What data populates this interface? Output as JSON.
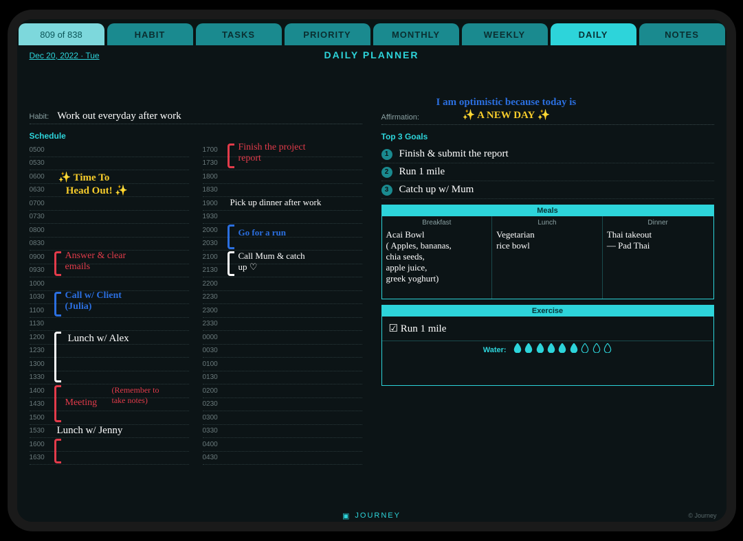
{
  "page_counter": "809 of 838",
  "tabs": {
    "habit": "HABIT",
    "tasks": "TASKS",
    "priority": "PRIORITY",
    "monthly": "MONTHLY",
    "weekly": "WEEKLY",
    "daily": "DAILY",
    "notes": "NOTES"
  },
  "date": "Dec 20, 2022 · Tue",
  "page_title": "DAILY PLANNER",
  "habit_field_label": "Habit:",
  "habit_value": "Work out everyday after work",
  "affirmation_field_label": "Affirmation:",
  "affirmation_line1": "I am optimistic because today is",
  "affirmation_line2": "✨ A NEW DAY ✨",
  "schedule_label": "Schedule",
  "schedule_times_col1": [
    "0500",
    "0530",
    "0600",
    "0630",
    "0700",
    "0730",
    "0800",
    "0830",
    "0900",
    "0930",
    "1000",
    "1030",
    "1100",
    "1130",
    "1200",
    "1230",
    "1300",
    "1330",
    "1400",
    "1430",
    "1500",
    "1530",
    "1600",
    "1630"
  ],
  "schedule_times_col2": [
    "1700",
    "1730",
    "1800",
    "1830",
    "1900",
    "1930",
    "2000",
    "2030",
    "2100",
    "2130",
    "2200",
    "2230",
    "2300",
    "2330",
    "0000",
    "0030",
    "0100",
    "0130",
    "0200",
    "0230",
    "0300",
    "0330",
    "0400",
    "0430"
  ],
  "schedule_entries": {
    "head_out": "✨ Time To\n   Head Out! ✨",
    "emails": "Answer & clear\nemails",
    "client_call": "Call w/ Client\n(Julia)",
    "lunch_alex": "Lunch w/ Alex",
    "meeting": "Meeting",
    "meeting_note": "(Remember to\ntake notes)",
    "lunch_jenny": "Lunch w/ Jenny",
    "finish_report": "Finish the project\nreport",
    "pickup_dinner": "Pick up dinner after work",
    "run": "Go for a run",
    "call_mum": "Call Mum & catch\nup ♡"
  },
  "goals_label": "Top 3 Goals",
  "goals": [
    "Finish & submit the report",
    "Run 1 mile",
    "Catch up w/ Mum"
  ],
  "meals_header": "Meals",
  "meals": {
    "breakfast_label": "Breakfast",
    "breakfast": "Acai Bowl\n( Apples, bananas,\nchia seeds,\napple juice,\ngreek yoghurt)",
    "lunch_label": "Lunch",
    "lunch": "Vegetarian\nrice bowl",
    "dinner_label": "Dinner",
    "dinner": "Thai takeout\n— Pad Thai"
  },
  "exercise_header": "Exercise",
  "exercise_value": "☑ Run 1 mile",
  "water_label": "Water:",
  "water_filled": 6,
  "water_total": 9,
  "footer_brand": "JOURNEY",
  "footer_copy": "© Journey"
}
